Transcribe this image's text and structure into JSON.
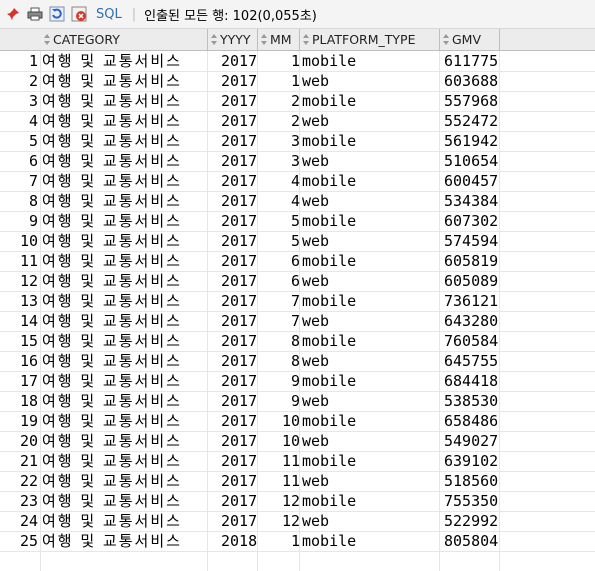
{
  "toolbar": {
    "sql_label": "SQL",
    "status_text": "인출된 모든 행: 102(0,055초)"
  },
  "columns": [
    {
      "key": "category",
      "label": "CATEGORY"
    },
    {
      "key": "yyyy",
      "label": "YYYY"
    },
    {
      "key": "mm",
      "label": "MM"
    },
    {
      "key": "platform_type",
      "label": "PLATFORM_TYPE"
    },
    {
      "key": "gmv",
      "label": "GMV"
    }
  ],
  "rows": [
    {
      "n": "1",
      "category": "여행 및 교통서비스",
      "yyyy": "2017",
      "mm": "1",
      "platform_type": "mobile",
      "gmv": "611775"
    },
    {
      "n": "2",
      "category": "여행 및 교통서비스",
      "yyyy": "2017",
      "mm": "1",
      "platform_type": "web",
      "gmv": "603688"
    },
    {
      "n": "3",
      "category": "여행 및 교통서비스",
      "yyyy": "2017",
      "mm": "2",
      "platform_type": "mobile",
      "gmv": "557968"
    },
    {
      "n": "4",
      "category": "여행 및 교통서비스",
      "yyyy": "2017",
      "mm": "2",
      "platform_type": "web",
      "gmv": "552472"
    },
    {
      "n": "5",
      "category": "여행 및 교통서비스",
      "yyyy": "2017",
      "mm": "3",
      "platform_type": "mobile",
      "gmv": "561942"
    },
    {
      "n": "6",
      "category": "여행 및 교통서비스",
      "yyyy": "2017",
      "mm": "3",
      "platform_type": "web",
      "gmv": "510654"
    },
    {
      "n": "7",
      "category": "여행 및 교통서비스",
      "yyyy": "2017",
      "mm": "4",
      "platform_type": "mobile",
      "gmv": "600457"
    },
    {
      "n": "8",
      "category": "여행 및 교통서비스",
      "yyyy": "2017",
      "mm": "4",
      "platform_type": "web",
      "gmv": "534384"
    },
    {
      "n": "9",
      "category": "여행 및 교통서비스",
      "yyyy": "2017",
      "mm": "5",
      "platform_type": "mobile",
      "gmv": "607302"
    },
    {
      "n": "10",
      "category": "여행 및 교통서비스",
      "yyyy": "2017",
      "mm": "5",
      "platform_type": "web",
      "gmv": "574594"
    },
    {
      "n": "11",
      "category": "여행 및 교통서비스",
      "yyyy": "2017",
      "mm": "6",
      "platform_type": "mobile",
      "gmv": "605819"
    },
    {
      "n": "12",
      "category": "여행 및 교통서비스",
      "yyyy": "2017",
      "mm": "6",
      "platform_type": "web",
      "gmv": "605089"
    },
    {
      "n": "13",
      "category": "여행 및 교통서비스",
      "yyyy": "2017",
      "mm": "7",
      "platform_type": "mobile",
      "gmv": "736121"
    },
    {
      "n": "14",
      "category": "여행 및 교통서비스",
      "yyyy": "2017",
      "mm": "7",
      "platform_type": "web",
      "gmv": "643280"
    },
    {
      "n": "15",
      "category": "여행 및 교통서비스",
      "yyyy": "2017",
      "mm": "8",
      "platform_type": "mobile",
      "gmv": "760584"
    },
    {
      "n": "16",
      "category": "여행 및 교통서비스",
      "yyyy": "2017",
      "mm": "8",
      "platform_type": "web",
      "gmv": "645755"
    },
    {
      "n": "17",
      "category": "여행 및 교통서비스",
      "yyyy": "2017",
      "mm": "9",
      "platform_type": "mobile",
      "gmv": "684418"
    },
    {
      "n": "18",
      "category": "여행 및 교통서비스",
      "yyyy": "2017",
      "mm": "9",
      "platform_type": "web",
      "gmv": "538530"
    },
    {
      "n": "19",
      "category": "여행 및 교통서비스",
      "yyyy": "2017",
      "mm": "10",
      "platform_type": "mobile",
      "gmv": "658486"
    },
    {
      "n": "20",
      "category": "여행 및 교통서비스",
      "yyyy": "2017",
      "mm": "10",
      "platform_type": "web",
      "gmv": "549027"
    },
    {
      "n": "21",
      "category": "여행 및 교통서비스",
      "yyyy": "2017",
      "mm": "11",
      "platform_type": "mobile",
      "gmv": "639102"
    },
    {
      "n": "22",
      "category": "여행 및 교통서비스",
      "yyyy": "2017",
      "mm": "11",
      "platform_type": "web",
      "gmv": "518560"
    },
    {
      "n": "23",
      "category": "여행 및 교통서비스",
      "yyyy": "2017",
      "mm": "12",
      "platform_type": "mobile",
      "gmv": "755350"
    },
    {
      "n": "24",
      "category": "여행 및 교통서비스",
      "yyyy": "2017",
      "mm": "12",
      "platform_type": "web",
      "gmv": "522992"
    },
    {
      "n": "25",
      "category": "여행 및 교통서비스",
      "yyyy": "2018",
      "mm": "1",
      "platform_type": "mobile",
      "gmv": "805804"
    }
  ]
}
